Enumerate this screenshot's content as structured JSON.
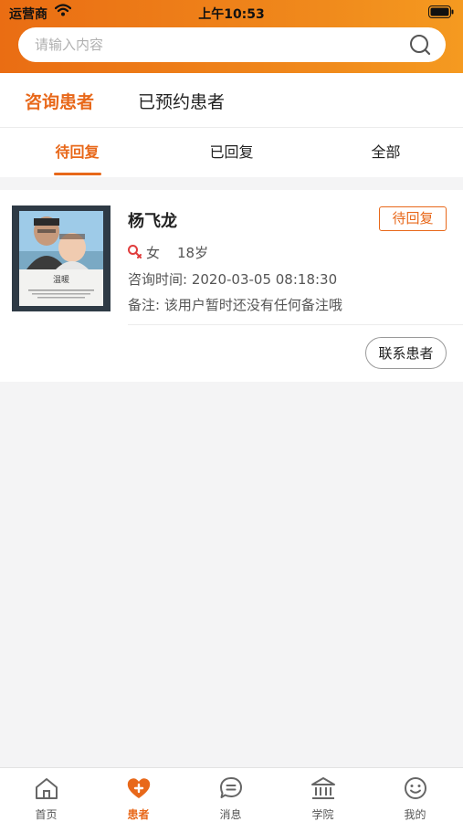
{
  "status_bar": {
    "carrier": "运营商",
    "time": "上午10:53"
  },
  "search": {
    "placeholder": "请输入内容"
  },
  "top_tabs": [
    {
      "label": "咨询患者",
      "active": true
    },
    {
      "label": "已预约患者",
      "active": false
    }
  ],
  "sub_tabs": [
    {
      "label": "待回复",
      "active": true
    },
    {
      "label": "已回复",
      "active": false
    },
    {
      "label": "全部",
      "active": false
    }
  ],
  "patients": [
    {
      "avatar_caption": "温暖",
      "name": "杨飞龙",
      "status": "待回复",
      "gender": "女",
      "age": "18岁",
      "consult_time": "咨询时间: 2020-03-05 08:18:30",
      "remark": "备注: 该用户暂时还没有任何备注哦",
      "contact_label": "联系患者"
    }
  ],
  "bottom_nav": [
    {
      "label": "首页",
      "icon": "home-icon",
      "active": false
    },
    {
      "label": "患者",
      "icon": "heart-plus-icon",
      "active": true
    },
    {
      "label": "消息",
      "icon": "message-icon",
      "active": false
    },
    {
      "label": "学院",
      "icon": "academy-icon",
      "active": false
    },
    {
      "label": "我的",
      "icon": "smile-icon",
      "active": false
    }
  ],
  "colors": {
    "accent": "#e8681a",
    "header_gradient_start": "#ea6d13",
    "header_gradient_end": "#f59a20"
  }
}
